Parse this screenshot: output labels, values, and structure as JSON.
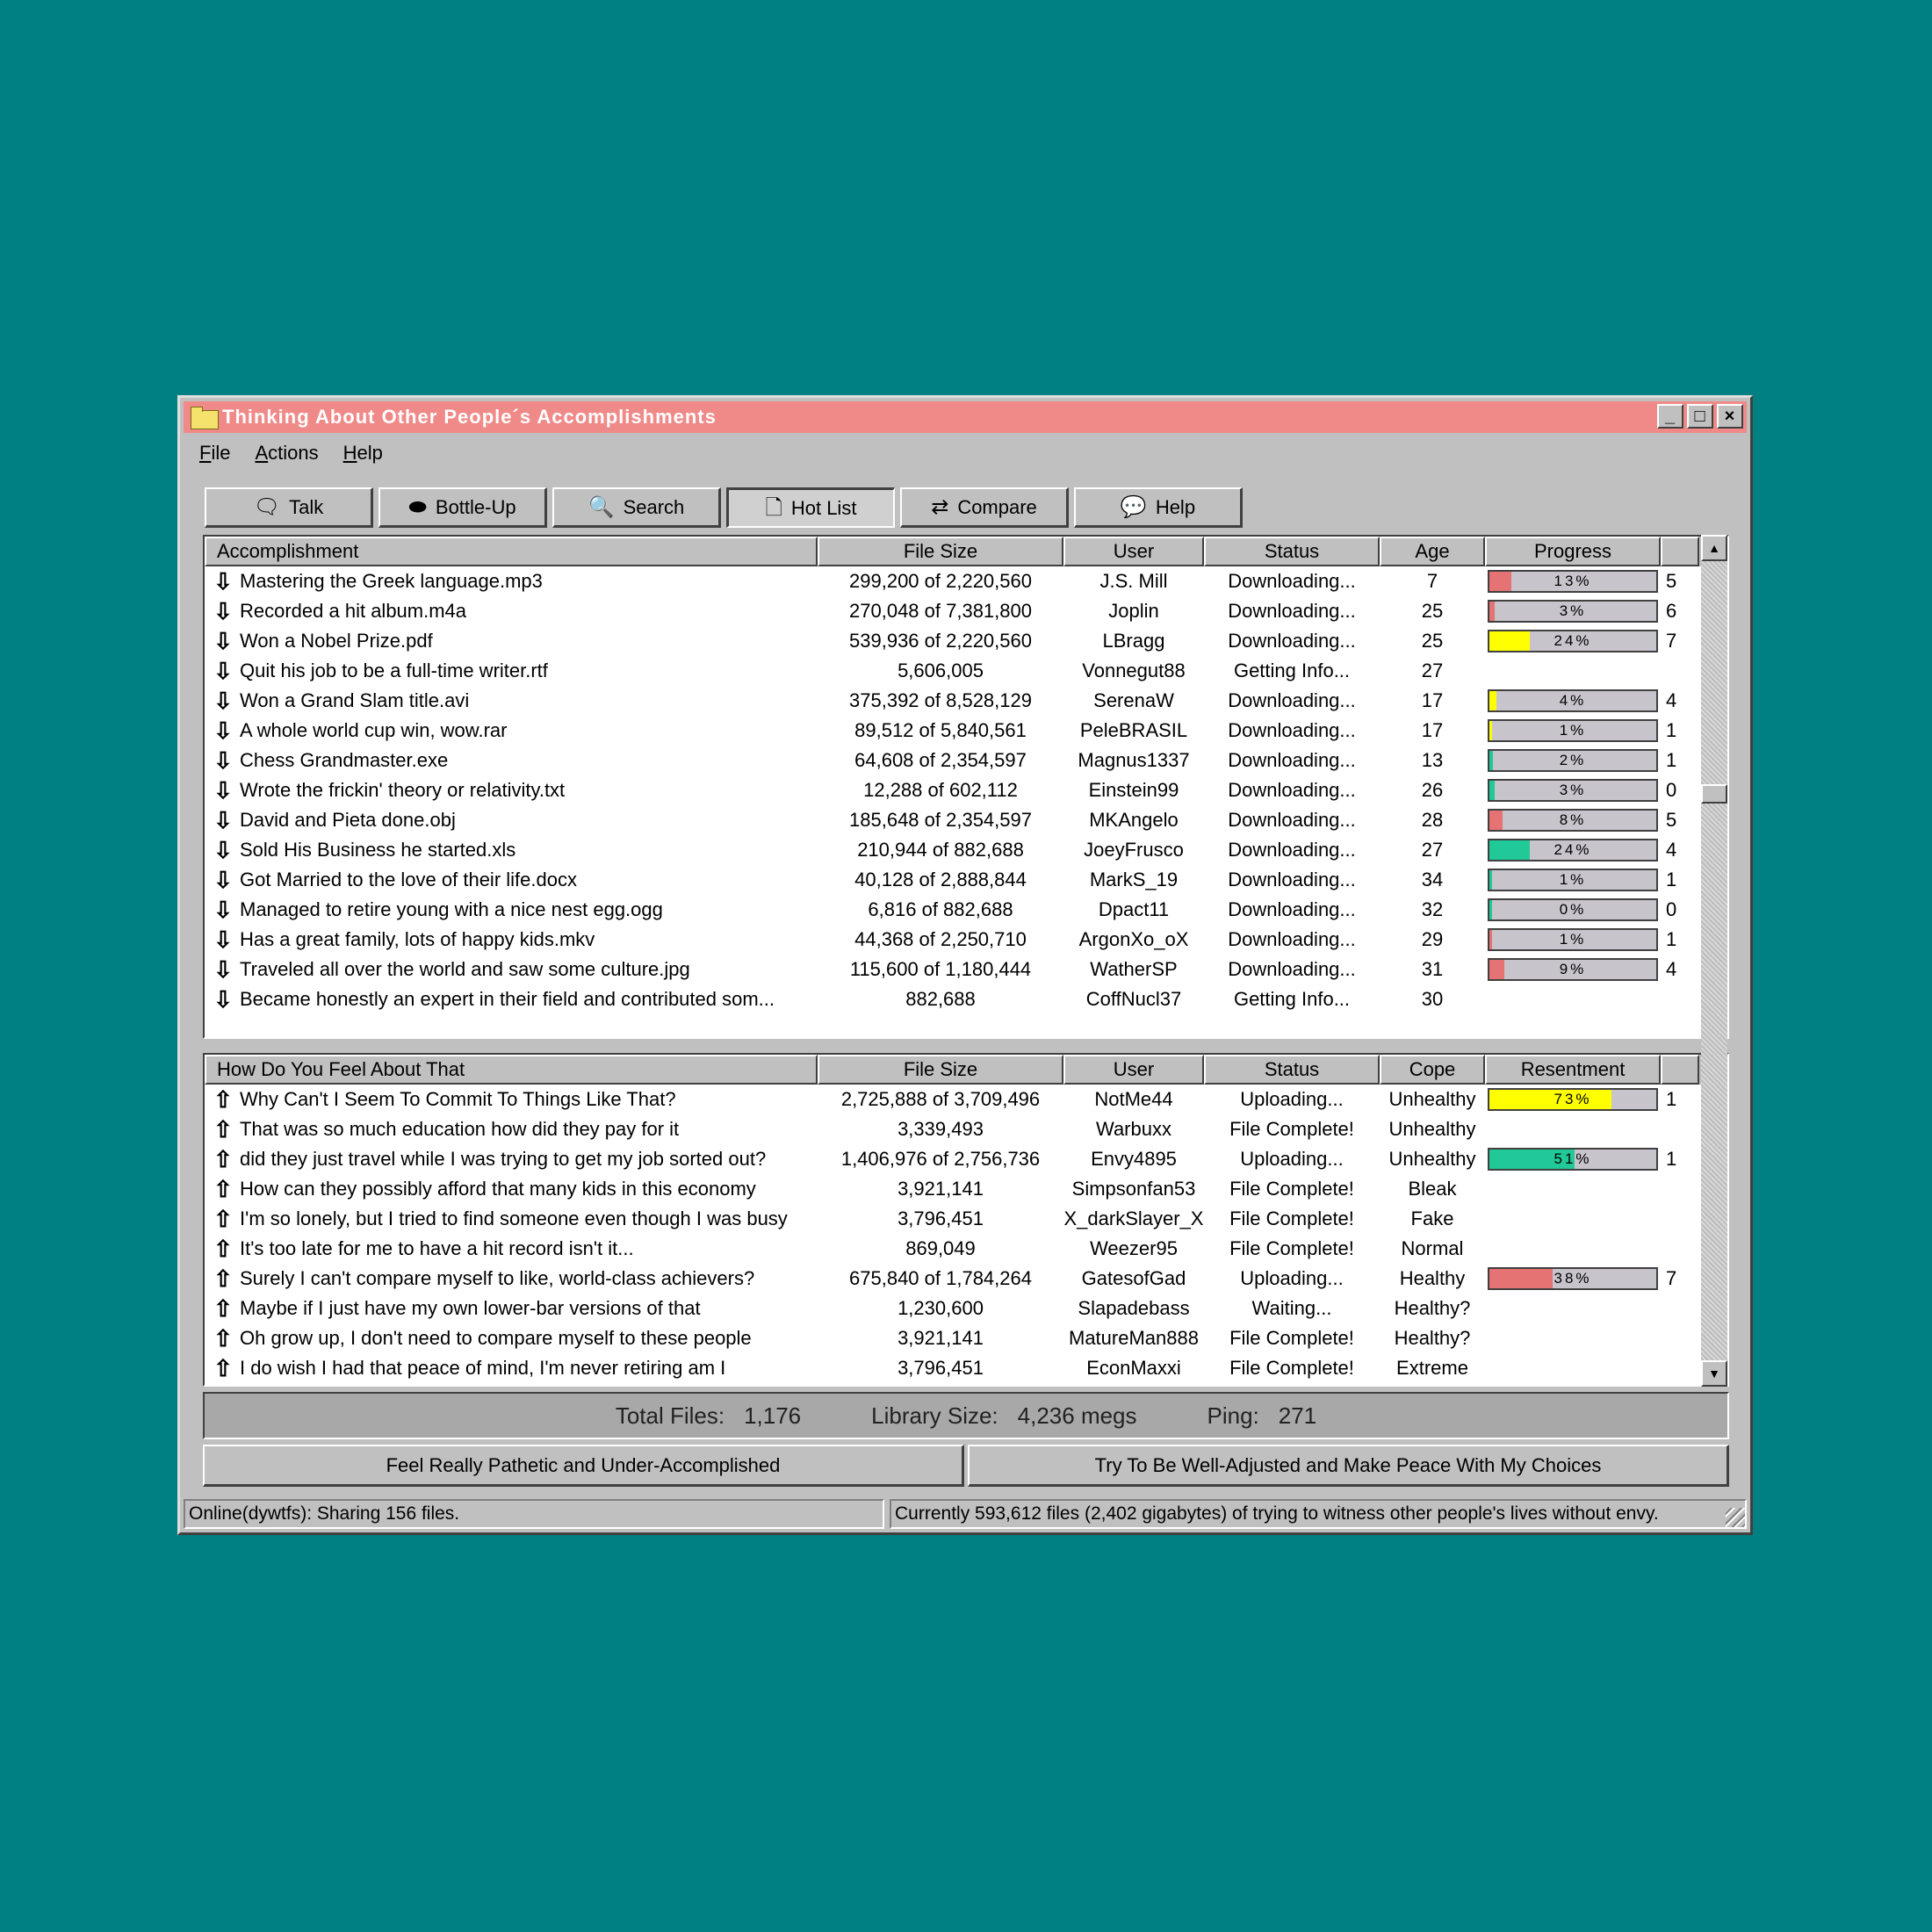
{
  "window": {
    "title": "Thinking About Other People´s Accomplishments",
    "controls": [
      "_",
      "□",
      "×"
    ]
  },
  "menu": [
    "File",
    "Actions",
    "Help"
  ],
  "toolbar": [
    {
      "label": "Talk",
      "icon": "speech-bubble-icon",
      "glyph": "🗨",
      "active": false
    },
    {
      "label": "Bottle-Up",
      "icon": "bottle-icon",
      "glyph": "⬬",
      "active": false
    },
    {
      "label": "Search",
      "icon": "magnifier-icon",
      "glyph": "🔍",
      "active": false
    },
    {
      "label": "Hot List",
      "icon": "document-icon",
      "glyph": "🗋",
      "active": true
    },
    {
      "label": "Compare",
      "icon": "swap-arrows-icon",
      "glyph": "⇄",
      "active": false
    },
    {
      "label": "Help",
      "icon": "help-bubble-icon",
      "glyph": "💬",
      "active": false
    }
  ],
  "downloads": {
    "headers": [
      "Accomplishment",
      "File Size",
      "User",
      "Status",
      "Age",
      "Progress",
      ""
    ],
    "rows": [
      {
        "name": "Mastering the Greek language.mp3",
        "size": "299,200 of 2,220,560",
        "user": "J.S. Mill",
        "status": "Downloading...",
        "age": "7",
        "progress": 13,
        "label": "13%",
        "color": "#e57373",
        "extra": "5"
      },
      {
        "name": "Recorded a hit album.m4a",
        "size": "270,048 of 7,381,800",
        "user": "Joplin",
        "status": "Downloading...",
        "age": "25",
        "progress": 3,
        "label": "3%",
        "color": "#e57373",
        "extra": "6"
      },
      {
        "name": "Won a Nobel Prize.pdf",
        "size": "539,936 of 2,220,560",
        "user": "LBragg",
        "status": "Downloading...",
        "age": "25",
        "progress": 24,
        "label": "24%",
        "color": "#ffff00",
        "extra": "7"
      },
      {
        "name": "Quit his job to be a full-time writer.rtf",
        "size": "5,606,005",
        "user": "Vonnegut88",
        "status": "Getting Info...",
        "age": "27",
        "progress": null,
        "label": "",
        "color": "",
        "extra": ""
      },
      {
        "name": "Won a Grand Slam title.avi",
        "size": "375,392 of 8,528,129",
        "user": "SerenaW",
        "status": "Downloading...",
        "age": "17",
        "progress": 4,
        "label": "4%",
        "color": "#ffff00",
        "extra": "4"
      },
      {
        "name": "A whole world cup win, wow.rar",
        "size": "89,512 of 5,840,561",
        "user": "PeleBRASIL",
        "status": "Downloading...",
        "age": "17",
        "progress": 1,
        "label": "1%",
        "color": "#ffff00",
        "extra": "1"
      },
      {
        "name": "Chess Grandmaster.exe",
        "size": "64,608 of 2,354,597",
        "user": "Magnus1337",
        "status": "Downloading...",
        "age": "13",
        "progress": 2,
        "label": "2%",
        "color": "#20c997",
        "extra": "1"
      },
      {
        "name": "Wrote the frickin' theory or relativity.txt",
        "size": "12,288 of 602,112",
        "user": "Einstein99",
        "status": "Downloading...",
        "age": "26",
        "progress": 3,
        "label": "3%",
        "color": "#20c997",
        "extra": "0"
      },
      {
        "name": "David and Pieta done.obj",
        "size": "185,648 of 2,354,597",
        "user": "MKAngelo",
        "status": "Downloading...",
        "age": "28",
        "progress": 8,
        "label": "8%",
        "color": "#e57373",
        "extra": "5"
      },
      {
        "name": "Sold His Business he started.xls",
        "size": "210,944 of 882,688",
        "user": "JoeyFrusco",
        "status": "Downloading...",
        "age": "27",
        "progress": 24,
        "label": "24%",
        "color": "#20c997",
        "extra": "4"
      },
      {
        "name": "Got Married to the love of their life.docx",
        "size": "40,128 of 2,888,844",
        "user": "MarkS_19",
        "status": "Downloading...",
        "age": "34",
        "progress": 1,
        "label": "1%",
        "color": "#20c997",
        "extra": "1"
      },
      {
        "name": "Managed to retire young with a nice nest egg.ogg",
        "size": "6,816 of 882,688",
        "user": "Dpact11",
        "status": "Downloading...",
        "age": "32",
        "progress": 0,
        "label": "0%",
        "color": "#20c997",
        "extra": "0"
      },
      {
        "name": "Has a great family, lots of happy kids.mkv",
        "size": "44,368 of 2,250,710",
        "user": "ArgonXo_oX",
        "status": "Downloading...",
        "age": "29",
        "progress": 1,
        "label": "1%",
        "color": "#e57373",
        "extra": "1"
      },
      {
        "name": "Traveled all over the world and saw some culture.jpg",
        "size": "115,600 of 1,180,444",
        "user": "WatherSP",
        "status": "Downloading...",
        "age": "31",
        "progress": 9,
        "label": "9%",
        "color": "#e57373",
        "extra": "4"
      },
      {
        "name": "Became honestly an expert in their field and contributed som...",
        "size": "882,688",
        "user": "CoffNucl37",
        "status": "Getting Info...",
        "age": "30",
        "progress": null,
        "label": "",
        "color": "",
        "extra": ""
      }
    ]
  },
  "uploads": {
    "headers": [
      "How Do You Feel About That",
      "File Size",
      "User",
      "Status",
      "Cope",
      "Resentment",
      ""
    ],
    "rows": [
      {
        "name": "Why Can't I Seem To Commit To Things Like That?",
        "size": "2,725,888 of 3,709,496",
        "user": "NotMe44",
        "status": "Uploading...",
        "cope": "Unhealthy",
        "progress": 73,
        "label": "73%",
        "color": "#ffff00",
        "extra": "1"
      },
      {
        "name": "That was so much education how did they pay for it",
        "size": "3,339,493",
        "user": "Warbuxx",
        "status": "File Complete!",
        "cope": "Unhealthy",
        "progress": null,
        "label": "",
        "color": "",
        "extra": ""
      },
      {
        "name": "did they just travel while I was trying to get my job sorted out?",
        "size": "1,406,976 of 2,756,736",
        "user": "Envy4895",
        "status": "Uploading...",
        "cope": "Unhealthy",
        "progress": 51,
        "label": "51%",
        "color": "#20c997",
        "extra": "1"
      },
      {
        "name": "How can they possibly afford that many kids in this economy",
        "size": "3,921,141",
        "user": "Simpsonfan53",
        "status": "File Complete!",
        "cope": "Bleak",
        "progress": null,
        "label": "",
        "color": "",
        "extra": ""
      },
      {
        "name": "I'm so lonely, but I tried to find someone even though I was busy",
        "size": "3,796,451",
        "user": "X_darkSlayer_X",
        "status": "File Complete!",
        "cope": "Fake",
        "progress": null,
        "label": "",
        "color": "",
        "extra": ""
      },
      {
        "name": "It's too late for me to have a hit record isn't it...",
        "size": "869,049",
        "user": "Weezer95",
        "status": "File Complete!",
        "cope": "Normal",
        "progress": null,
        "label": "",
        "color": "",
        "extra": ""
      },
      {
        "name": "Surely I can't compare myself to like, world-class achievers?",
        "size": "675,840 of 1,784,264",
        "user": "GatesofGad",
        "status": "Uploading...",
        "cope": "Healthy",
        "progress": 38,
        "label": "38%",
        "color": "#e57373",
        "extra": "7"
      },
      {
        "name": "Maybe if I just have my own lower-bar versions of that",
        "size": "1,230,600",
        "user": "Slapadebass",
        "status": "Waiting...",
        "cope": "Healthy?",
        "progress": null,
        "label": "",
        "color": "",
        "extra": ""
      },
      {
        "name": "Oh grow up, I don't need to compare myself to these people",
        "size": "3,921,141",
        "user": "MatureMan888",
        "status": "File Complete!",
        "cope": "Healthy?",
        "progress": null,
        "label": "",
        "color": "",
        "extra": ""
      },
      {
        "name": "I do wish I had that peace of mind, I'm never retiring am I",
        "size": "3,796,451",
        "user": "EconMaxxi",
        "status": "File Complete!",
        "cope": "Extreme",
        "progress": null,
        "label": "",
        "color": "",
        "extra": ""
      }
    ]
  },
  "totals": {
    "files_label": "Total Files:",
    "files_value": "1,176",
    "library_label": "Library Size:",
    "library_value": "4,236 megs",
    "ping_label": "Ping:",
    "ping_value": "271"
  },
  "actions": {
    "left": "Feel Really Pathetic and Under-Accomplished",
    "right": "Try To Be Well-Adjusted and Make Peace With My Choices"
  },
  "status": {
    "left": "Online(dywtfs): Sharing 156 files.",
    "right": "Currently 593,612 files (2,402 gigabytes) of trying to witness other people's lives without envy."
  }
}
